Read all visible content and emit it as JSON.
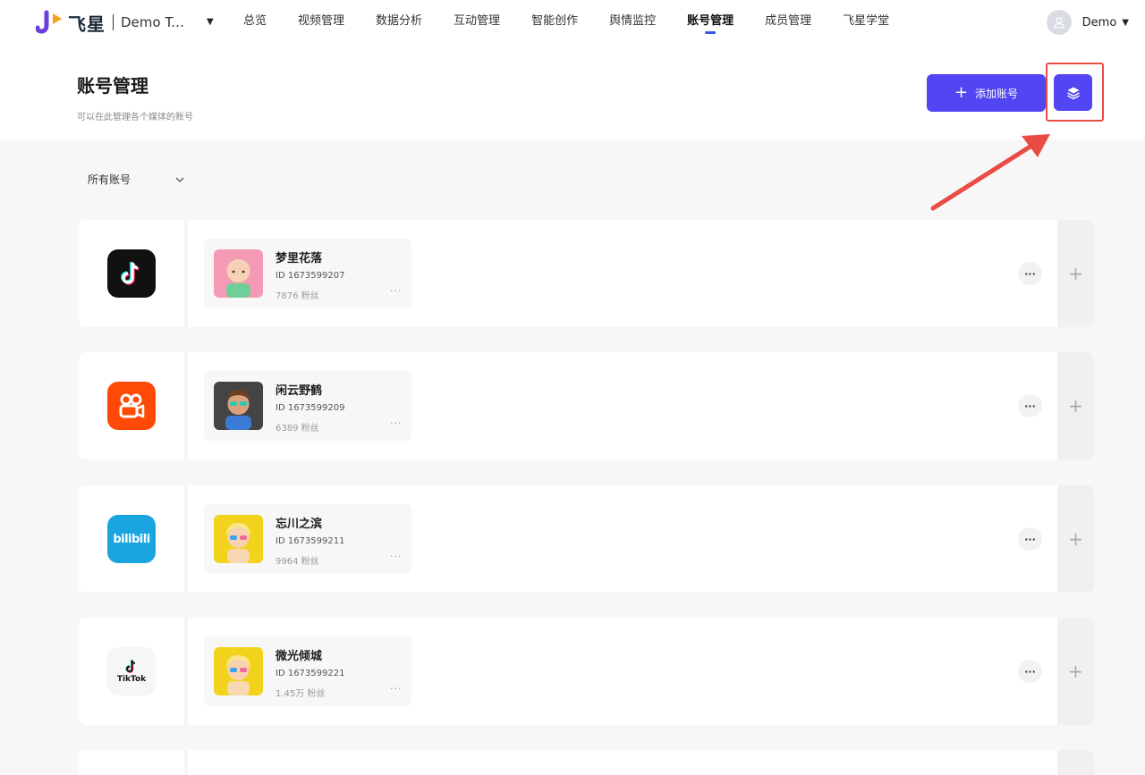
{
  "nav": {
    "brand": "飞星",
    "team": "Demo Team",
    "menu": [
      "总览",
      "视频管理",
      "数据分析",
      "互动管理",
      "智能创作",
      "舆情监控",
      "账号管理",
      "成员管理",
      "飞星学堂"
    ],
    "active_index": 6,
    "user": "Demo"
  },
  "header": {
    "title": "账号管理",
    "description": "可以在此管理各个媒体的账号",
    "add_button": "添加账号"
  },
  "filter": {
    "label": "所有账号"
  },
  "accounts": [
    {
      "platform": "douyin",
      "name": "梦里花落",
      "id": "ID 1673599207",
      "fans": "7876 粉丝"
    },
    {
      "platform": "kuaishou",
      "name": "闲云野鹤",
      "id": "ID 1673599209",
      "fans": "6389 粉丝"
    },
    {
      "platform": "bilibili",
      "name": "忘川之滨",
      "id": "ID 1673599211",
      "fans": "9964 粉丝"
    },
    {
      "platform": "tiktok",
      "name": "微光倾城",
      "id": "ID 1673599221",
      "fans": "1.45万 粉丝"
    }
  ],
  "platform_labels": {
    "bilibili": "bilibili",
    "tiktok": "TikTok"
  },
  "colors": {
    "primary": "#5245f2",
    "highlight": "#e84c45",
    "nav_active": "#3c57e8"
  }
}
